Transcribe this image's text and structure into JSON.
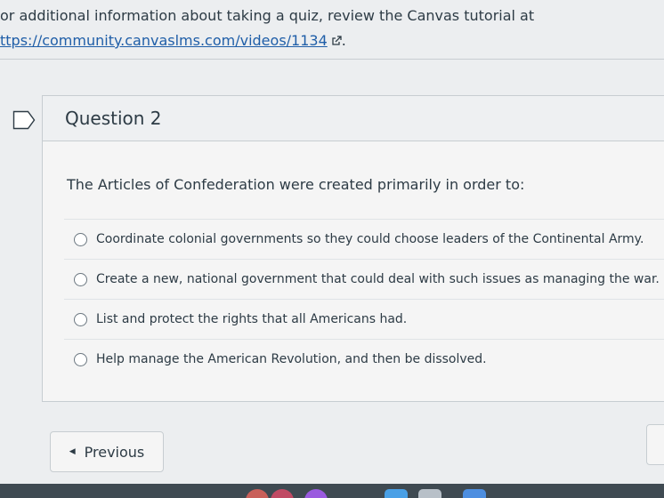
{
  "intro": {
    "text": "or additional information about taking a quiz, review the Canvas tutorial at",
    "link": "ttps://community.canvaslms.com/videos/1134",
    "period": "."
  },
  "question": {
    "title": "Question 2",
    "text": "The Articles of Confederation were created primarily in order to:",
    "answers": [
      "Coordinate colonial governments so they could choose leaders of the Continental Army.",
      "Create a new, national government that could deal with such issues as managing the war.",
      "List and protect the rights that all Americans had.",
      "Help manage the American Revolution, and then be dissolved."
    ]
  },
  "navigation": {
    "previous_label": "Previous"
  },
  "icons": {
    "external_link": "external-link-icon",
    "flag": "flag-icon",
    "radio": "radio-icon",
    "caret": "caret-left-icon"
  },
  "colors": {
    "link": "#1f5ea8",
    "text": "#2d3b45",
    "background": "#eceef0",
    "card": "#f5f5f5",
    "taskbar": "#3f4a52"
  }
}
